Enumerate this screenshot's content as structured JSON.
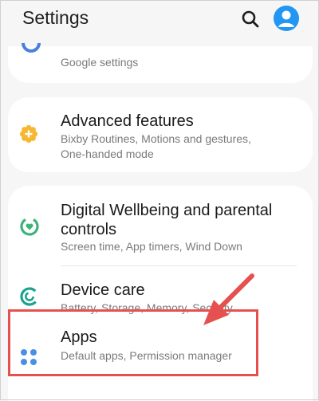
{
  "header": {
    "title": "Settings"
  },
  "google": {
    "subtitle": "Google settings"
  },
  "advanced": {
    "title": "Advanced features",
    "subtitle_line1": "Bixby Routines, Motions and gestures,",
    "subtitle_line2": "One-handed mode"
  },
  "wellbeing": {
    "title_line1": "Digital Wellbeing and parental",
    "title_line2": "controls",
    "subtitle": "Screen time, App timers, Wind Down"
  },
  "device_care": {
    "title": "Device care",
    "subtitle": "Battery, Storage, Memory, Security"
  },
  "apps": {
    "title": "Apps",
    "subtitle": "Default apps, Permission manager"
  },
  "colors": {
    "accent": "#2196f3",
    "advanced_icon": "#f7b733",
    "wellbeing_icon": "#3db37a",
    "device_care_icon": "#1aa38f",
    "apps_icon": "#4a8fe7",
    "annotation": "#e5514f"
  },
  "icons": {
    "search": "search-icon",
    "avatar": "avatar-icon",
    "advanced": "plus-gear-icon",
    "wellbeing": "heart-ring-icon",
    "device_care": "refresh-ring-icon",
    "apps": "grid-dots-icon",
    "google": "google-icon",
    "annotation": "arrow-icon"
  }
}
